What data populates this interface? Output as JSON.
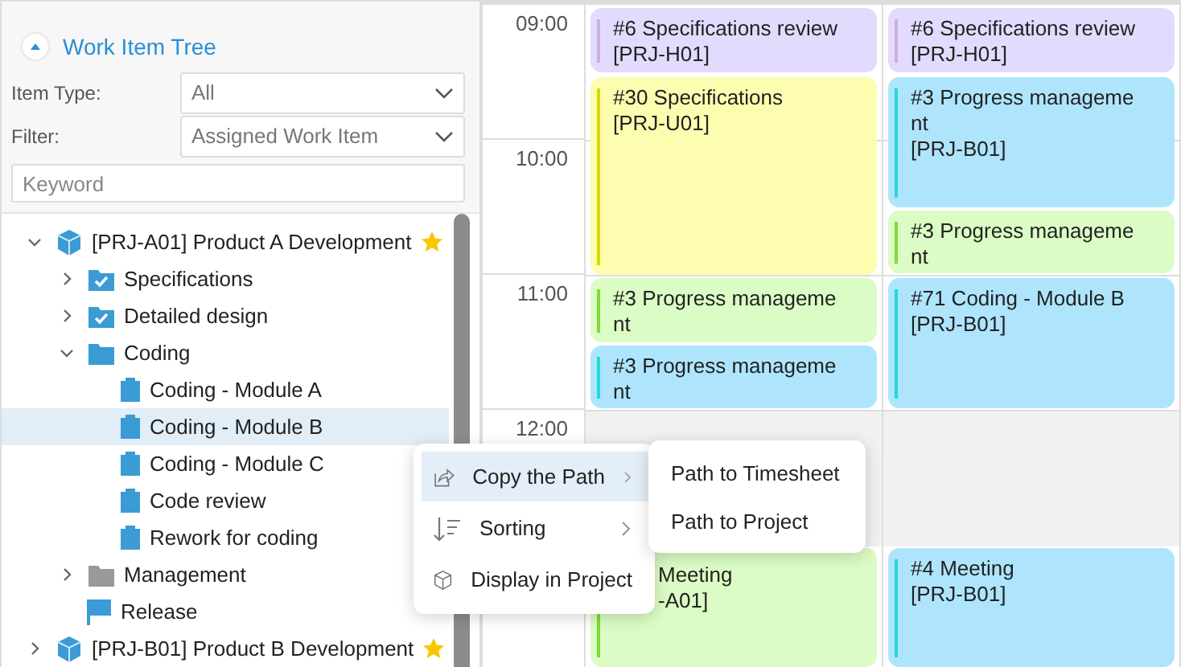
{
  "panel": {
    "title": "Work Item Tree",
    "expanded": true,
    "filters": [
      {
        "label": "Item Type:",
        "value": "All"
      },
      {
        "label": "Filter:",
        "value": "Assigned Work Item"
      }
    ],
    "search": {
      "placeholder": "Keyword"
    }
  },
  "tree": [
    {
      "label": "[PRJ-A01] Product A Development",
      "kind": "project",
      "starred": true,
      "expanded": true,
      "selected": false,
      "children": [
        {
          "label": "Specifications",
          "kind": "checked-folder",
          "expanded": false,
          "selected": false,
          "has_children": true
        },
        {
          "label": "Detailed design",
          "kind": "checked-folder",
          "expanded": false,
          "selected": false,
          "has_children": true
        },
        {
          "label": "Coding",
          "kind": "folder",
          "expanded": true,
          "selected": false,
          "has_children": true,
          "children": [
            {
              "label": "Coding - Module A",
              "kind": "task",
              "selected": false
            },
            {
              "label": "Coding - Module B",
              "kind": "task",
              "selected": true
            },
            {
              "label": "Coding - Module C",
              "kind": "task",
              "selected": false
            },
            {
              "label": "Code review",
              "kind": "task",
              "selected": false
            },
            {
              "label": "Rework for coding",
              "kind": "task",
              "selected": false
            }
          ]
        },
        {
          "label": "Management",
          "kind": "gray-folder",
          "expanded": false,
          "selected": false,
          "has_children": true
        },
        {
          "label": "Release",
          "kind": "milestone",
          "selected": false
        }
      ]
    },
    {
      "label": "[PRJ-B01] Product B Development",
      "kind": "project",
      "starred": true,
      "expanded": false,
      "selected": false,
      "has_children": true
    }
  ],
  "calendar": {
    "hours": [
      "09:00",
      "10:00",
      "11:00",
      "12:00"
    ],
    "columns": [
      [
        {
          "title": "#6 Specifications review",
          "project": "[PRJ-H01]",
          "color": "#e3dbfd"
        },
        {
          "title": "#30 Specifications",
          "project": "[PRJ-U01]",
          "color": "#fdfdb0"
        },
        {
          "title": "#3 Progress manageme\nnt",
          "color": "#dbfcc5"
        },
        {
          "title": "#3 Progress manageme\nnt",
          "color": "#aee5fd"
        },
        {
          "title": "Meeting",
          "project": "-A01]",
          "color": "#dbfcc5"
        }
      ],
      [
        {
          "title": "#6 Specifications review",
          "project": "[PRJ-H01]",
          "color": "#e3dbfd"
        },
        {
          "title": "#3 Progress manageme\nnt",
          "project": "[PRJ-B01]",
          "color": "#aee5fd"
        },
        {
          "title": "#3 Progress manageme\nnt",
          "color": "#dbfcc5"
        },
        {
          "title": "#71 Coding - Module B",
          "project": "[PRJ-B01]",
          "color": "#aee5fd"
        },
        {
          "title": "#4 Meeting",
          "project": "[PRJ-B01]",
          "color": "#aee5fd"
        }
      ]
    ]
  },
  "context_menu": {
    "items": [
      {
        "label": "Copy the Path",
        "kind": "share",
        "selected": true,
        "has_submenu": true
      },
      {
        "label": "Sorting",
        "kind": "sort",
        "selected": false,
        "has_submenu": true
      },
      {
        "label": "Display in Project",
        "kind": "cube",
        "selected": false,
        "has_submenu": false
      }
    ],
    "submenu": [
      "Path to Timesheet",
      "Path to Project"
    ]
  }
}
